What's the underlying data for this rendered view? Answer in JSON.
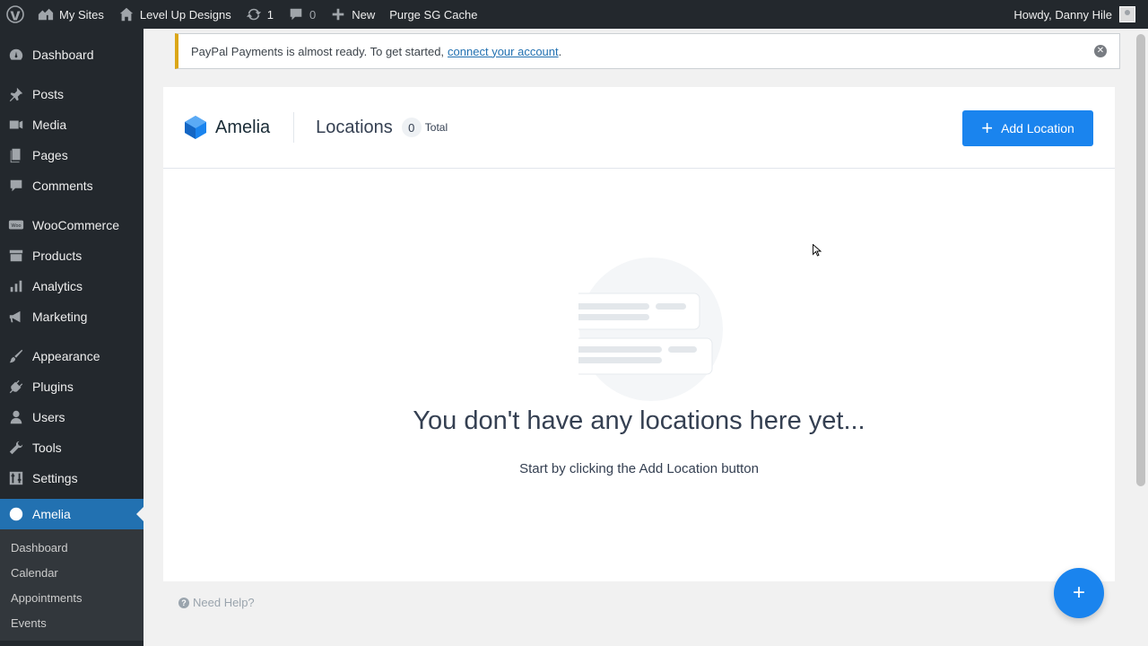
{
  "adminbar": {
    "my_sites": "My Sites",
    "site_name": "Level Up Designs",
    "updates_count": "1",
    "comments_count": "0",
    "new_label": "New",
    "purge_label": "Purge SG Cache",
    "greeting": "Howdy, Danny Hile"
  },
  "sidebar": {
    "items": [
      {
        "label": "Dashboard",
        "icon": "dashboard-icon"
      },
      {
        "label": "Posts",
        "icon": "pin-icon"
      },
      {
        "label": "Media",
        "icon": "media-icon"
      },
      {
        "label": "Pages",
        "icon": "pages-icon"
      },
      {
        "label": "Comments",
        "icon": "comment-icon"
      },
      {
        "label": "WooCommerce",
        "icon": "woo-icon"
      },
      {
        "label": "Products",
        "icon": "archive-icon"
      },
      {
        "label": "Analytics",
        "icon": "bar-chart-icon"
      },
      {
        "label": "Marketing",
        "icon": "megaphone-icon"
      },
      {
        "label": "Appearance",
        "icon": "brush-icon"
      },
      {
        "label": "Plugins",
        "icon": "plug-icon"
      },
      {
        "label": "Users",
        "icon": "user-icon"
      },
      {
        "label": "Tools",
        "icon": "wrench-icon"
      },
      {
        "label": "Settings",
        "icon": "sliders-icon"
      },
      {
        "label": "Amelia",
        "icon": "amelia-icon"
      }
    ],
    "submenu": [
      "Dashboard",
      "Calendar",
      "Appointments",
      "Events"
    ]
  },
  "notice": {
    "text": "PayPal Payments is almost ready. To get started,",
    "link": "connect your account",
    "suffix": "."
  },
  "amelia": {
    "logo_text": "Amelia",
    "page_title": "Locations",
    "count": "0",
    "count_label": "Total",
    "add_button": "Add Location",
    "empty_title": "You don't have any locations here yet...",
    "empty_subtitle": "Start by clicking the Add Location button",
    "help": "Need Help?",
    "fab": "+"
  },
  "colors": {
    "accent": "#1a84ee",
    "admin_bg": "#23282d",
    "menu_active": "#2271b1",
    "notice_warning": "#dba617"
  }
}
